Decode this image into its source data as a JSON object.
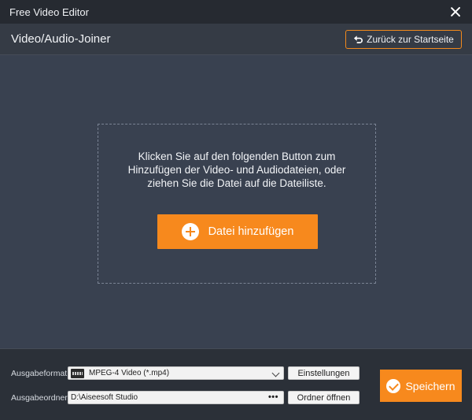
{
  "window": {
    "title": "Free Video Editor",
    "close_icon": "close-icon"
  },
  "header": {
    "page_title": "Video/Audio-Joiner",
    "back_button_label": "Zurück zur Startseite",
    "back_icon": "return-arrow-icon"
  },
  "dropzone": {
    "hint_lines": [
      "Klicken Sie auf den folgenden Button zum",
      "Hinzufügen der Video- und Audiodateien, oder",
      "ziehen Sie die Datei auf die Dateiliste."
    ],
    "add_button_label": "Datei hinzufügen",
    "add_icon": "plus-circle-icon"
  },
  "footer": {
    "format_label": "Ausgabeformat:",
    "format_value": "MPEG-4 Video (*.mp4)",
    "settings_button_label": "Einstellungen",
    "folder_label": "Ausgabeordner:",
    "folder_value": "D:\\Aiseesoft Studio",
    "folder_browse_label": "•••",
    "open_folder_button_label": "Ordner öffnen",
    "save_button_label": "Speichern",
    "save_icon": "check-circle-icon"
  },
  "colors": {
    "accent": "#f7891d",
    "background": "#394150",
    "titlebar": "#262a31"
  }
}
